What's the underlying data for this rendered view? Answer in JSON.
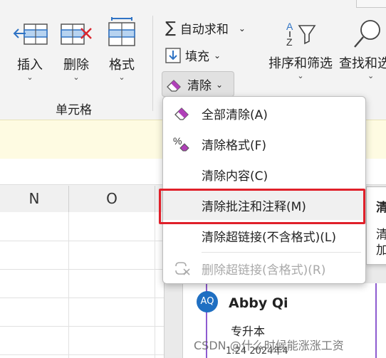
{
  "ribbon": {
    "insert_label": "插入",
    "delete_label": "删除",
    "format_label": "格式",
    "cells_group_label": "单元格",
    "autosum_label": "自动求和",
    "fill_label": "填充",
    "clear_label": "清除",
    "sort_filter_label": "排序和筛选",
    "find_select_label": "查找和选"
  },
  "columns": [
    "N",
    "O"
  ],
  "clear_menu": {
    "items": [
      {
        "label": "全部清除(A)",
        "icon": "eraser-clear-icon",
        "state": "normal"
      },
      {
        "label": "清除格式(F)",
        "icon": "percent-eraser-icon",
        "state": "normal"
      },
      {
        "label": "清除内容(C)",
        "icon": "",
        "state": "normal"
      },
      {
        "label": "清除批注和注释(M)",
        "icon": "",
        "state": "hover"
      },
      {
        "label": "清除超链接(不含格式)(L)",
        "icon": "",
        "state": "normal"
      },
      {
        "label": "删除超链接(含格式)(R)",
        "icon": "link-remove-icon",
        "state": "disabled"
      }
    ]
  },
  "tooltip": {
    "title": "清",
    "line1": "清",
    "line2": "加"
  },
  "comment_card": {
    "avatar_initials": "AQ",
    "author": "Abby Qi",
    "subtitle": "专升本",
    "timestamp": "1:24 2024年4"
  },
  "watermark": "CSDN @什么时候能涨涨工资",
  "colors": {
    "highlight_red": "#e0202a",
    "avatar_blue": "#1f6fc2",
    "notice_bg": "#fefbe2",
    "eraser_purple": "#b040b8"
  }
}
